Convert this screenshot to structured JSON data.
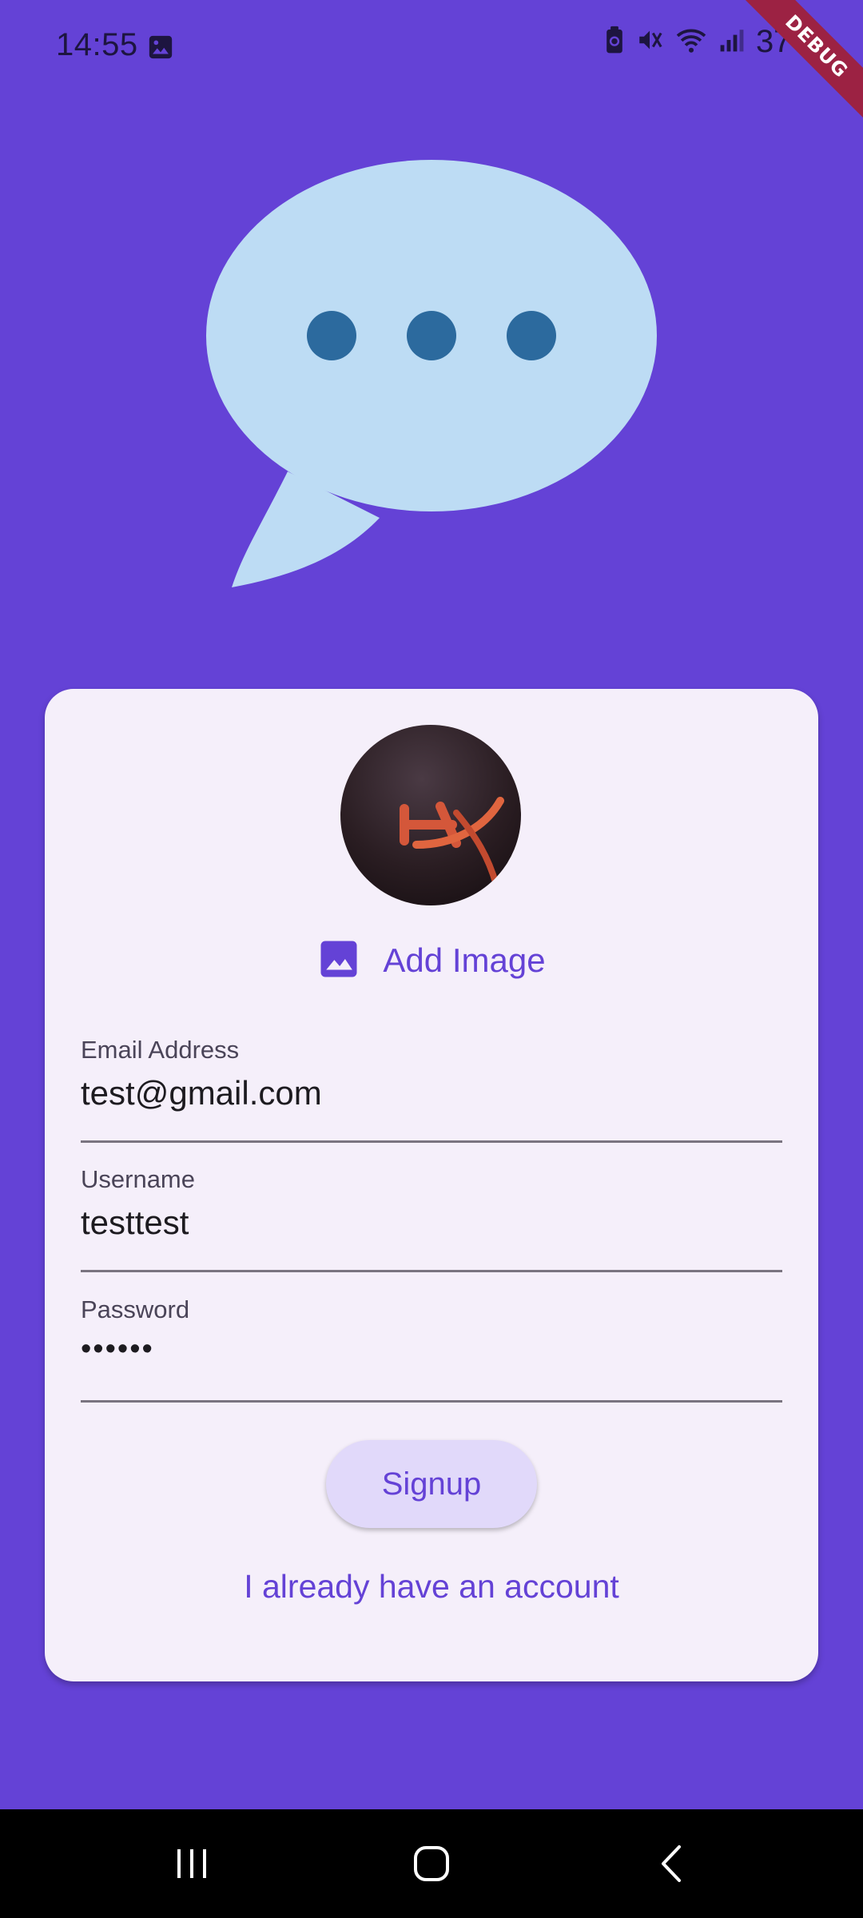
{
  "status_bar": {
    "time": "14:55",
    "left_icons": [
      "image-icon"
    ],
    "right_icons": [
      "battery-saver-icon",
      "mute-icon",
      "wifi-icon",
      "signal-icon"
    ],
    "battery_percent": "37%"
  },
  "debug_banner": "DEBUG",
  "logo": {
    "icon": "chat-bubble-icon",
    "bubble_color": "#BDDCF4",
    "dot_color": "#2C6A9E"
  },
  "form": {
    "avatar": {
      "icon": "user-avatar",
      "text": "HX"
    },
    "add_image_label": "Add Image",
    "email": {
      "label": "Email Address",
      "value": "test@gmail.com"
    },
    "username": {
      "label": "Username",
      "value": "testtest"
    },
    "password": {
      "label": "Password",
      "value": "••••••"
    },
    "signup_label": "Signup",
    "login_link": "I already have an account"
  },
  "navigation": {
    "buttons": [
      "recents-icon",
      "home-icon",
      "back-icon"
    ]
  },
  "colors": {
    "background": "#6442D6",
    "card": "#F5EFFA",
    "accent": "#6442D6",
    "button_bg": "#E1D9FA"
  }
}
